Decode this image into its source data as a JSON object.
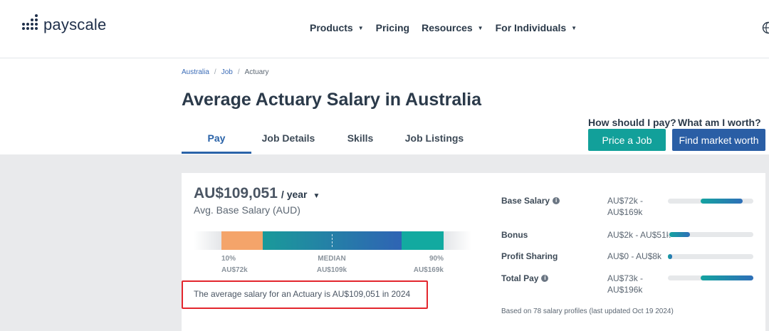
{
  "header": {
    "brand": "payscale",
    "nav": [
      {
        "label": "Products",
        "has_caret": true
      },
      {
        "label": "Pricing",
        "has_caret": false
      },
      {
        "label": "Resources",
        "has_caret": true
      },
      {
        "label": "For Individuals",
        "has_caret": true
      }
    ],
    "globe_icon": "globe-icon"
  },
  "breadcrumb": [
    "Australia",
    "Job",
    "Actuary"
  ],
  "page_title": "Average Actuary Salary in Australia",
  "tabs": [
    {
      "label": "Pay",
      "active": true
    },
    {
      "label": "Job Details",
      "active": false
    },
    {
      "label": "Skills",
      "active": false
    },
    {
      "label": "Job Listings",
      "active": false
    }
  ],
  "cta": {
    "pay_question": "How should I pay?",
    "pay_button": "Price a Job",
    "worth_question": "What am I worth?",
    "worth_button": "Find market worth"
  },
  "salary": {
    "amount": "AU$109,051",
    "period": "/ year",
    "subtitle": "Avg. Base Salary (AUD)",
    "percentiles": [
      {
        "label": "10%",
        "value": "AU$72k"
      },
      {
        "label": "MEDIAN",
        "value": "AU$109k"
      },
      {
        "label": "90%",
        "value": "AU$169k"
      }
    ],
    "note": "The average salary for an Actuary is AU$109,051 in 2024"
  },
  "stats": [
    {
      "label": "Base Salary",
      "info": true,
      "range_lines": [
        "AU$72k -",
        "AU$169k"
      ],
      "fill_start": 0.38,
      "fill_end": 0.87
    },
    {
      "label": "Bonus",
      "info": false,
      "range_lines": [
        "AU$2k - AU$51k"
      ],
      "fill_start": 0.02,
      "fill_end": 0.26
    },
    {
      "label": "Profit Sharing",
      "info": false,
      "range_lines": [
        "AU$0 - AU$8k"
      ],
      "fill_start": 0.0,
      "fill_end": 0.05
    },
    {
      "label": "Total Pay",
      "info": true,
      "range_lines": [
        "AU$73k -",
        "AU$196k"
      ],
      "fill_start": 0.38,
      "fill_end": 1.0
    }
  ],
  "footnote": "Based on 78 salary profiles (last updated Oct 19 2024)",
  "colors": {
    "brand_navy": "#1f2f4a",
    "teal_button": "#12a09a",
    "blue_button": "#2a5ea5",
    "seg_low": "#f4a46a",
    "seg_mid_start": "#1a9a9a",
    "seg_mid_end": "#2f64b4",
    "seg_high": "#12aaa0",
    "highlight_box": "#e3262d"
  }
}
